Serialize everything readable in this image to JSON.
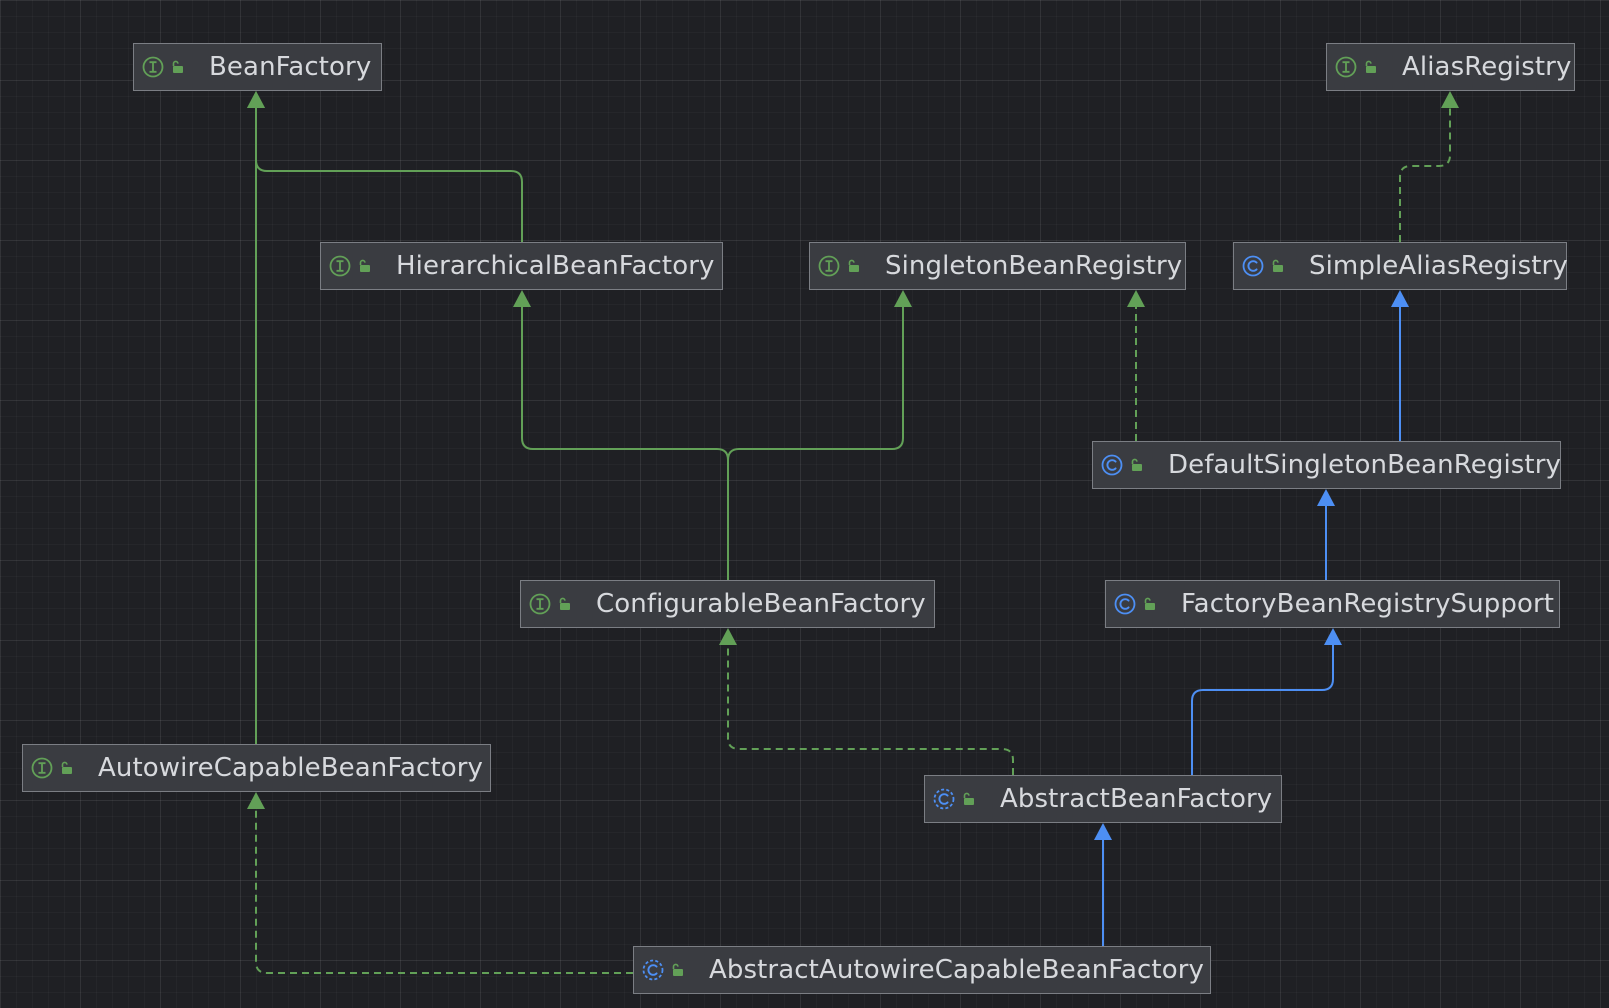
{
  "colors": {
    "background": "#1f2024",
    "node_fill": "#3a3c41",
    "node_border": "#7b7e84",
    "label": "#d7d9dd",
    "interface_accent": "#62a057",
    "class_accent": "#4d8ff4"
  },
  "nodes": [
    {
      "id": "BeanFactory",
      "label": "BeanFactory",
      "kind": "interface",
      "kind_icon": "interface-icon",
      "access_icon": "public-access-icon"
    },
    {
      "id": "AliasRegistry",
      "label": "AliasRegistry",
      "kind": "interface",
      "kind_icon": "interface-icon",
      "access_icon": "public-access-icon"
    },
    {
      "id": "HierarchicalBeanFactory",
      "label": "HierarchicalBeanFactory",
      "kind": "interface",
      "kind_icon": "interface-icon",
      "access_icon": "public-access-icon"
    },
    {
      "id": "SingletonBeanRegistry",
      "label": "SingletonBeanRegistry",
      "kind": "interface",
      "kind_icon": "interface-icon",
      "access_icon": "public-access-icon"
    },
    {
      "id": "SimpleAliasRegistry",
      "label": "SimpleAliasRegistry",
      "kind": "class",
      "kind_icon": "class-icon",
      "access_icon": "public-access-icon"
    },
    {
      "id": "DefaultSingletonBeanRegistry",
      "label": "DefaultSingletonBeanRegistry",
      "kind": "class",
      "kind_icon": "class-icon",
      "access_icon": "public-access-icon"
    },
    {
      "id": "ConfigurableBeanFactory",
      "label": "ConfigurableBeanFactory",
      "kind": "interface",
      "kind_icon": "interface-icon",
      "access_icon": "public-access-icon"
    },
    {
      "id": "FactoryBeanRegistrySupport",
      "label": "FactoryBeanRegistrySupport",
      "kind": "class",
      "kind_icon": "class-icon",
      "access_icon": "public-access-icon"
    },
    {
      "id": "AutowireCapableBeanFactory",
      "label": "AutowireCapableBeanFactory",
      "kind": "interface",
      "kind_icon": "interface-icon",
      "access_icon": "public-access-icon"
    },
    {
      "id": "AbstractBeanFactory",
      "label": "AbstractBeanFactory",
      "kind": "class",
      "kind_icon": "abstract-class-icon",
      "access_icon": "public-access-icon"
    },
    {
      "id": "AbstractAutowireCapableBeanFactory",
      "label": "AbstractAutowireCapableBeanFactory",
      "kind": "class",
      "kind_icon": "abstract-class-icon",
      "access_icon": "public-access-icon"
    }
  ],
  "edges": [
    {
      "from": "HierarchicalBeanFactory",
      "to": "BeanFactory",
      "relation": "extends",
      "style": "solid",
      "color": "#62a057"
    },
    {
      "from": "AutowireCapableBeanFactory",
      "to": "BeanFactory",
      "relation": "extends",
      "style": "solid",
      "color": "#62a057"
    },
    {
      "from": "ConfigurableBeanFactory",
      "to": "HierarchicalBeanFactory",
      "relation": "extends",
      "style": "solid",
      "color": "#62a057"
    },
    {
      "from": "ConfigurableBeanFactory",
      "to": "SingletonBeanRegistry",
      "relation": "extends",
      "style": "solid",
      "color": "#62a057"
    },
    {
      "from": "DefaultSingletonBeanRegistry",
      "to": "SingletonBeanRegistry",
      "relation": "implements",
      "style": "dashed",
      "color": "#62a057"
    },
    {
      "from": "SimpleAliasRegistry",
      "to": "AliasRegistry",
      "relation": "implements",
      "style": "dashed",
      "color": "#62a057"
    },
    {
      "from": "DefaultSingletonBeanRegistry",
      "to": "SimpleAliasRegistry",
      "relation": "extends",
      "style": "solid",
      "color": "#4d8ff4"
    },
    {
      "from": "FactoryBeanRegistrySupport",
      "to": "DefaultSingletonBeanRegistry",
      "relation": "extends",
      "style": "solid",
      "color": "#4d8ff4"
    },
    {
      "from": "AbstractBeanFactory",
      "to": "FactoryBeanRegistrySupport",
      "relation": "extends",
      "style": "solid",
      "color": "#4d8ff4"
    },
    {
      "from": "AbstractBeanFactory",
      "to": "ConfigurableBeanFactory",
      "relation": "implements",
      "style": "dashed",
      "color": "#62a057"
    },
    {
      "from": "AbstractAutowireCapableBeanFactory",
      "to": "AbstractBeanFactory",
      "relation": "extends",
      "style": "solid",
      "color": "#4d8ff4"
    },
    {
      "from": "AbstractAutowireCapableBeanFactory",
      "to": "AutowireCapableBeanFactory",
      "relation": "implements",
      "style": "dashed",
      "color": "#62a057"
    }
  ]
}
